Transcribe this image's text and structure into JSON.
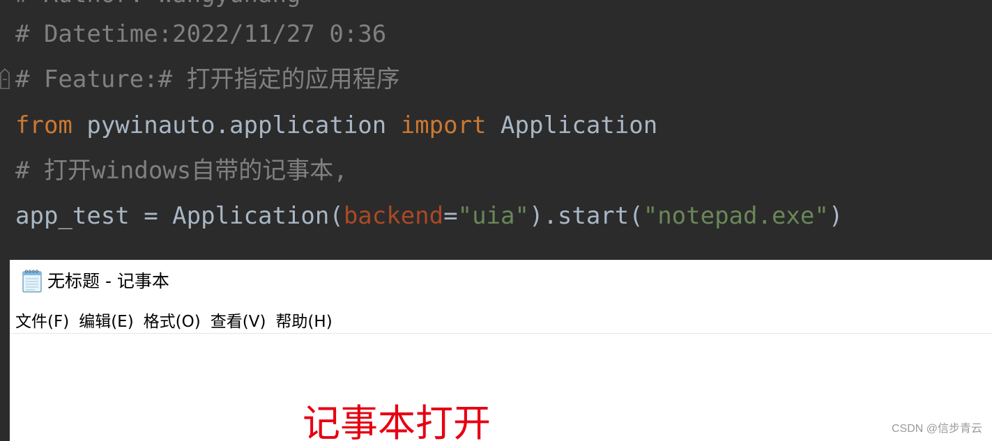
{
  "editor": {
    "partial_line": "# Author: Wangyuhang",
    "lines": {
      "datetime": "# Datetime:2022/11/27 0:36",
      "feature": "# Feature:# 打开指定的应用程序",
      "import_from": "from",
      "import_module": " pywinauto.application ",
      "import_kw": "import",
      "import_name": " Application",
      "comment_open": "# 打开windows自带的记事本,",
      "assign_lhs": "app_test = Application(",
      "param_name": "backend",
      "eq": "=",
      "param_value": "\"uia\"",
      "call_mid": ").start(",
      "call_arg": "\"notepad.exe\"",
      "call_end": ")"
    },
    "colors": {
      "background": "#2b2b2b",
      "comment": "#808080",
      "keyword": "#cc7832",
      "identifier": "#a9b7c6",
      "parameter": "#aa4926",
      "string": "#6a8759"
    }
  },
  "notepad": {
    "title": "无标题 - 记事本",
    "icon": "notepad-icon",
    "menu": [
      "文件(F)",
      "编辑(E)",
      "格式(O)",
      "查看(V)",
      "帮助(H)"
    ],
    "annotation": "记事本打开",
    "annotation_color": "#e60012"
  },
  "watermark": "CSDN @信步青云"
}
